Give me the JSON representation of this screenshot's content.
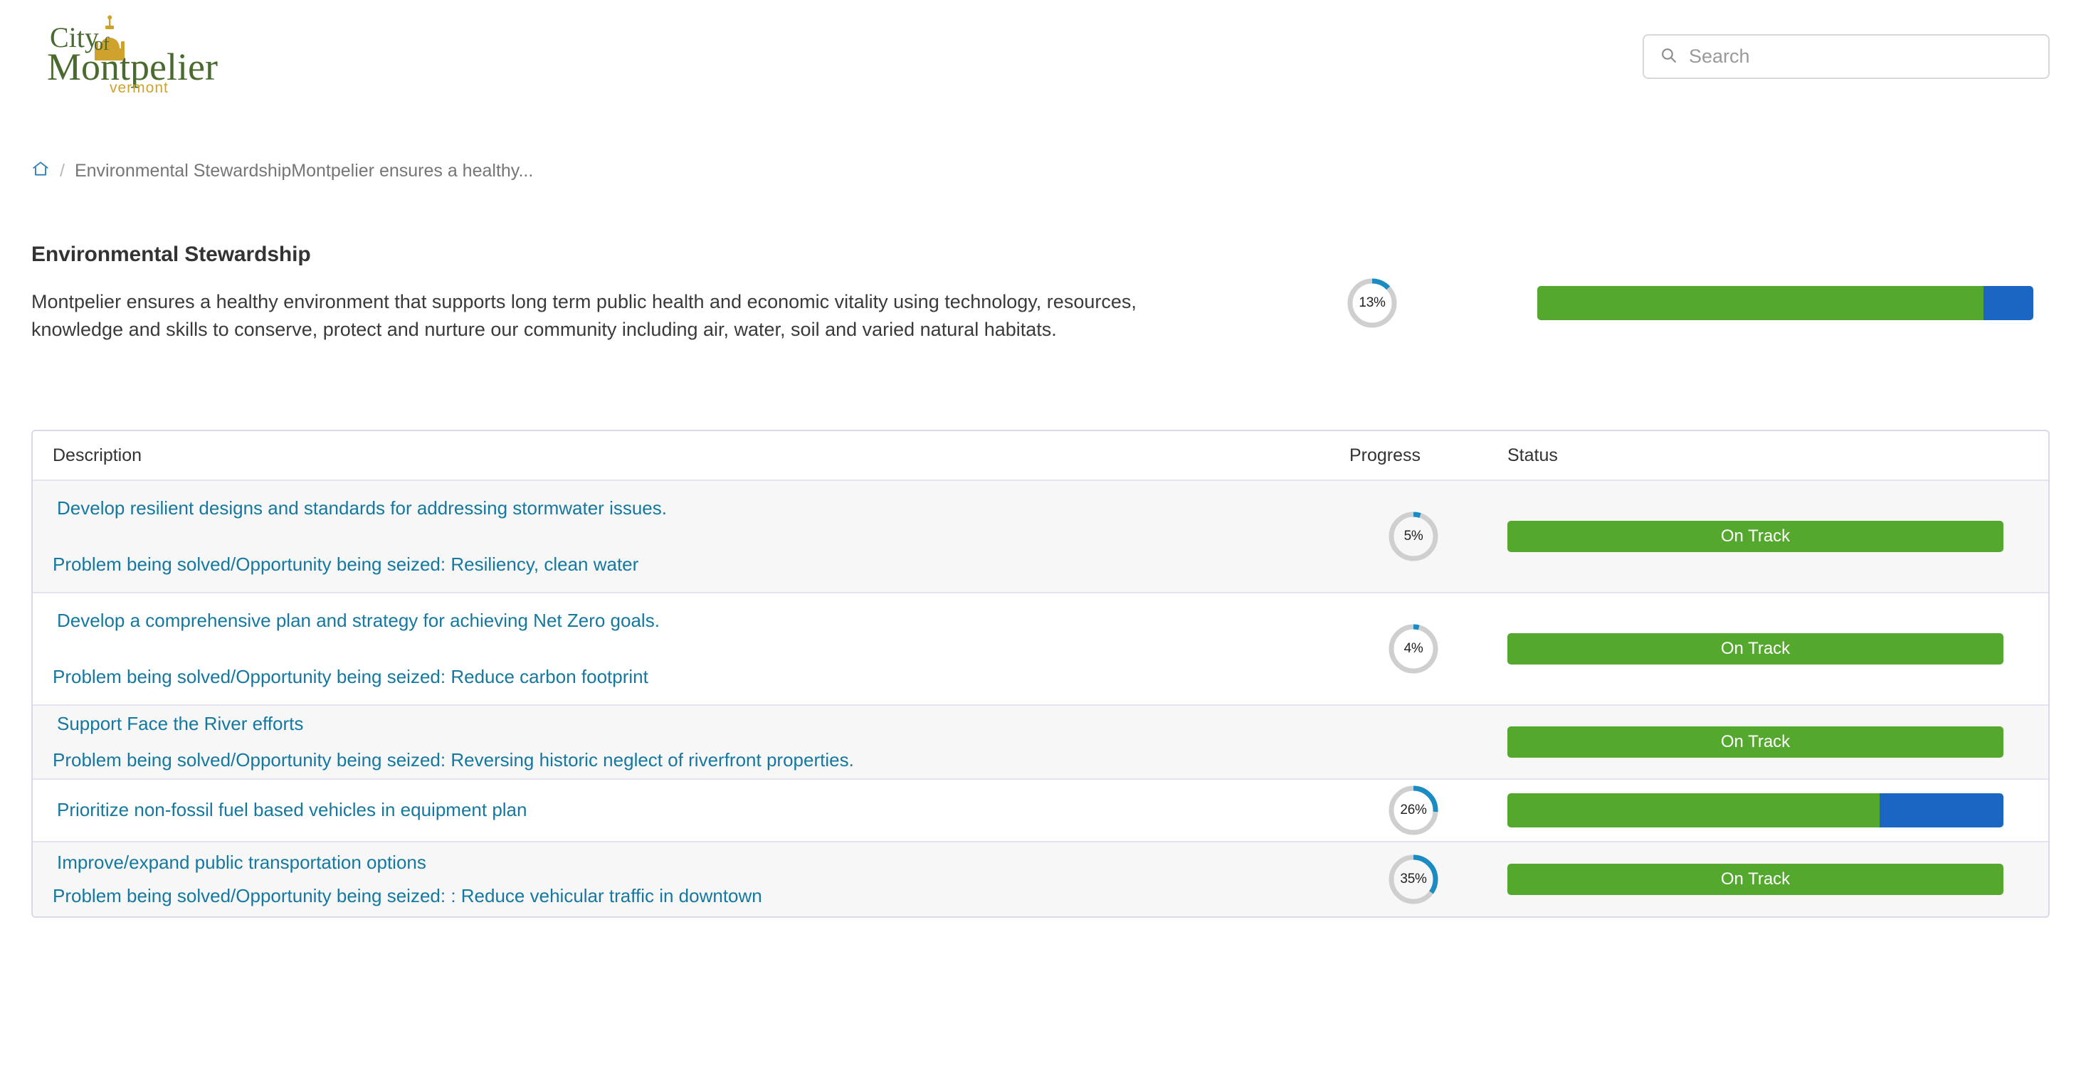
{
  "header": {
    "logo": {
      "line1": "City",
      "line1_small": "of",
      "line2": "Montpelier",
      "line3": "vermont",
      "green": "#4a6b30",
      "gold": "#cfa22e"
    },
    "search": {
      "placeholder": "Search",
      "value": "",
      "icon": "search-icon"
    }
  },
  "breadcrumb": {
    "home_icon": "home-icon",
    "separator": "/",
    "current": "Environmental StewardshipMontpelier ensures a healthy..."
  },
  "page": {
    "title": "Environmental Stewardship",
    "description": "Montpelier ensures a healthy environment that supports long term public health and economic vitality using technology, resources, knowledge and skills to conserve, protect and nurture our community including air, water, soil and varied natural habitats.",
    "overall_progress_percent": 13,
    "overall_progress_label": "13%",
    "overall_status_bar": {
      "green_percent": 90,
      "blue_percent": 10
    }
  },
  "colors": {
    "green": "#55a82e",
    "blue": "#1a66c2",
    "donut_arc": "#1b8bc4",
    "donut_track": "#cfcfcf",
    "link": "#1478a0",
    "table_border": "#d9dae8"
  },
  "table": {
    "columns": [
      "Description",
      "Progress",
      "Status"
    ],
    "rows": [
      {
        "title": "Develop resilient designs and standards for addressing stormwater issues.",
        "subtitle": "Problem being solved/Opportunity being seized:  Resiliency, clean water",
        "progress_percent": 5,
        "progress_label": "5%",
        "status_type": "badge",
        "status_label": "On Track"
      },
      {
        "title": "Develop a comprehensive plan and strategy for achieving Net Zero goals.",
        "subtitle": "Problem being solved/Opportunity being seized:  Reduce carbon footprint",
        "progress_percent": 4,
        "progress_label": "4%",
        "status_type": "badge",
        "status_label": "On Track"
      },
      {
        "title": "Support Face the River efforts",
        "subtitle": "Problem being solved/Opportunity being seized:   Reversing historic neglect of riverfront properties.",
        "progress_percent": null,
        "progress_label": "",
        "status_type": "badge",
        "status_label": "On Track"
      },
      {
        "title": "Prioritize non-fossil fuel based vehicles in equipment plan",
        "subtitle": "",
        "progress_percent": 26,
        "progress_label": "26%",
        "status_type": "bar",
        "status_label": "",
        "status_bar": {
          "green_percent": 75,
          "blue_percent": 25
        }
      },
      {
        "title": "Improve/expand public transportation options",
        "subtitle": "Problem being solved/Opportunity being seized:  : Reduce vehicular traffic in downtown",
        "progress_percent": 35,
        "progress_label": "35%",
        "status_type": "badge",
        "status_label": "On Track"
      }
    ]
  }
}
